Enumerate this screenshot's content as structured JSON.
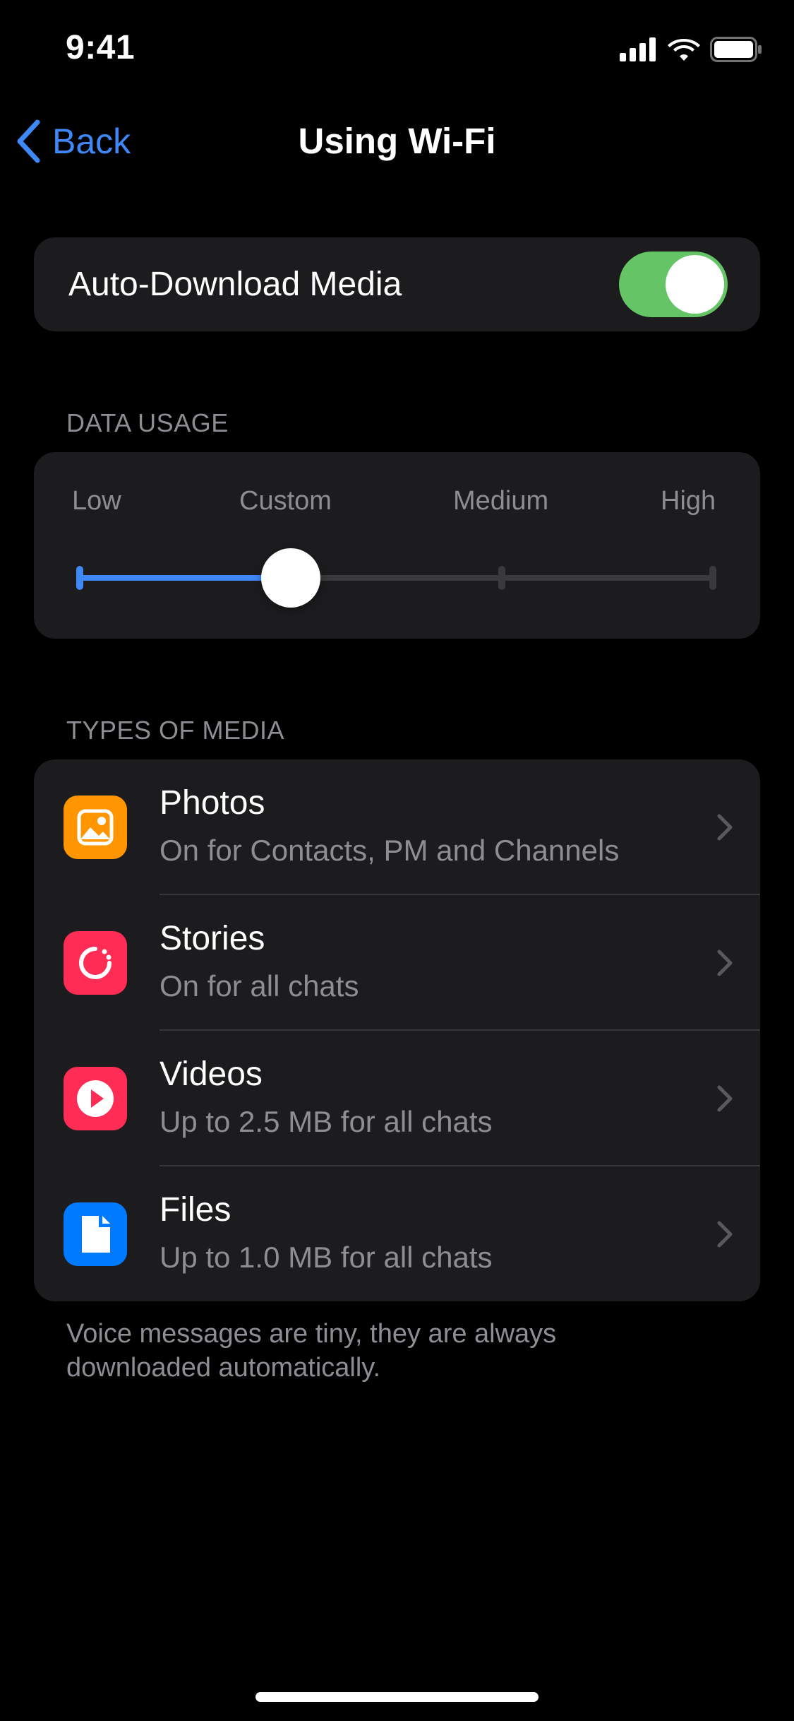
{
  "status_bar": {
    "time": "9:41",
    "icons": [
      "cellular-signal-icon",
      "wifi-icon",
      "battery-icon"
    ]
  },
  "nav": {
    "back_label": "Back",
    "title": "Using Wi-Fi"
  },
  "auto_download": {
    "label": "Auto-Download Media",
    "enabled": true
  },
  "data_usage": {
    "header": "DATA USAGE",
    "levels": [
      "Low",
      "Custom",
      "Medium",
      "High"
    ],
    "selected": "Custom"
  },
  "media": {
    "header": "TYPES OF MEDIA",
    "items": [
      {
        "title": "Photos",
        "subtitle": "On for Contacts, PM and Channels",
        "icon": "photo-icon",
        "color": "#ff9500"
      },
      {
        "title": "Stories",
        "subtitle": "On for all chats",
        "icon": "stories-icon",
        "color": "#ff2d55"
      },
      {
        "title": "Videos",
        "subtitle": "Up to 2.5 MB for all chats",
        "icon": "play-icon",
        "color": "#ff2d55"
      },
      {
        "title": "Files",
        "subtitle": "Up to 1.0 MB for all chats",
        "icon": "file-icon",
        "color": "#007aff"
      }
    ],
    "footer": "Voice messages are tiny, they are always downloaded automatically."
  },
  "colors": {
    "accent": "#3e88f7",
    "toggle_on": "#65c466",
    "cell_background": "#1c1c1e",
    "secondary_text": "#8d8d93"
  }
}
